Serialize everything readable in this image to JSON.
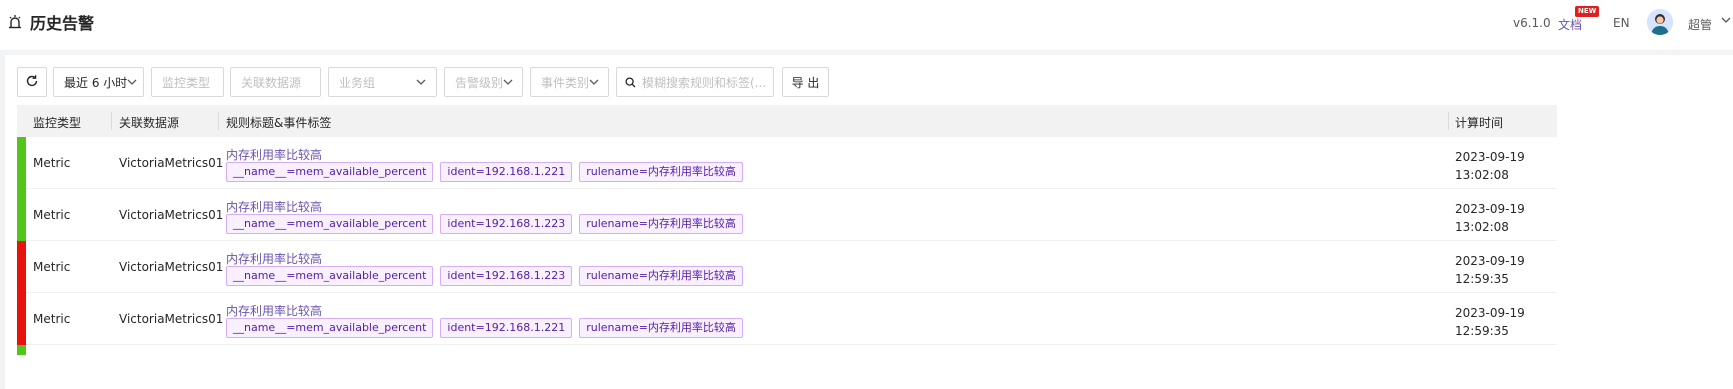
{
  "header": {
    "title": "历史告警",
    "version": "v6.1.0",
    "docs": "文档",
    "docs_badge": "NEW",
    "lang": "EN",
    "user": "超管"
  },
  "toolbar": {
    "time_range": "最近 6 小时",
    "monitor_type_placeholder": "监控类型",
    "datasource_placeholder": "关联数据源",
    "business_group_placeholder": "业务组",
    "severity_placeholder": "告警级别",
    "event_type_placeholder": "事件类别",
    "search_placeholder": "模糊搜索规则和标签(...",
    "export_label": "导 出"
  },
  "table": {
    "columns": [
      "监控类型",
      "关联数据源",
      "规则标题&事件标签",
      "计算时间"
    ],
    "rows": [
      {
        "severity_color": "#52c41a",
        "type": "Metric",
        "datasource": "VictoriaMetrics01",
        "rule": "内存利用率比较高",
        "tags": [
          "__name__=mem_available_percent",
          "ident=192.168.1.221",
          "rulename=内存利用率比较高"
        ],
        "date": "2023-09-19",
        "time": "13:02:08"
      },
      {
        "severity_color": "#52c41a",
        "type": "Metric",
        "datasource": "VictoriaMetrics01",
        "rule": "内存利用率比较高",
        "tags": [
          "__name__=mem_available_percent",
          "ident=192.168.1.223",
          "rulename=内存利用率比较高"
        ],
        "date": "2023-09-19",
        "time": "13:02:08"
      },
      {
        "severity_color": "#e8120c",
        "type": "Metric",
        "datasource": "VictoriaMetrics01",
        "rule": "内存利用率比较高",
        "tags": [
          "__name__=mem_available_percent",
          "ident=192.168.1.223",
          "rulename=内存利用率比较高"
        ],
        "date": "2023-09-19",
        "time": "12:59:35"
      },
      {
        "severity_color": "#e8120c",
        "type": "Metric",
        "datasource": "VictoriaMetrics01",
        "rule": "内存利用率比较高",
        "tags": [
          "__name__=mem_available_percent",
          "ident=192.168.1.221",
          "rulename=内存利用率比较高"
        ],
        "date": "2023-09-19",
        "time": "12:59:35"
      }
    ],
    "next_row_severity_color": "#52c41a"
  }
}
